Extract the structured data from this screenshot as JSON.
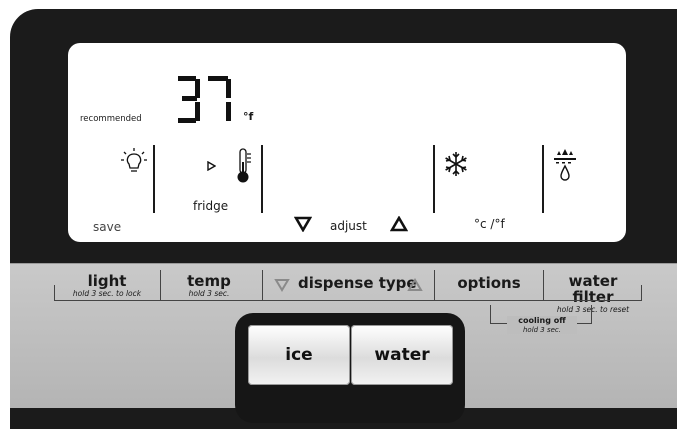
{
  "display": {
    "recommended_label": "recommended",
    "temperature_unit": "°f",
    "save_label": "save",
    "fridge_label": "fridge",
    "adjust_label": "adjust",
    "unit_toggle_label": "°c /°f"
  },
  "panel": {
    "light": {
      "label": "light",
      "hint": "hold 3 sec. to lock"
    },
    "temp": {
      "label": "temp",
      "hint": "hold 3 sec."
    },
    "dispense_type": {
      "label": "dispense type"
    },
    "options": {
      "label": "options"
    },
    "water_filter": {
      "label": "water filter",
      "hint": "hold 3 sec. to reset"
    },
    "cooling_off": {
      "label": "cooling off",
      "hint": "hold 3 sec."
    }
  },
  "dispenser": {
    "ice_label": "ice",
    "water_label": "water"
  }
}
